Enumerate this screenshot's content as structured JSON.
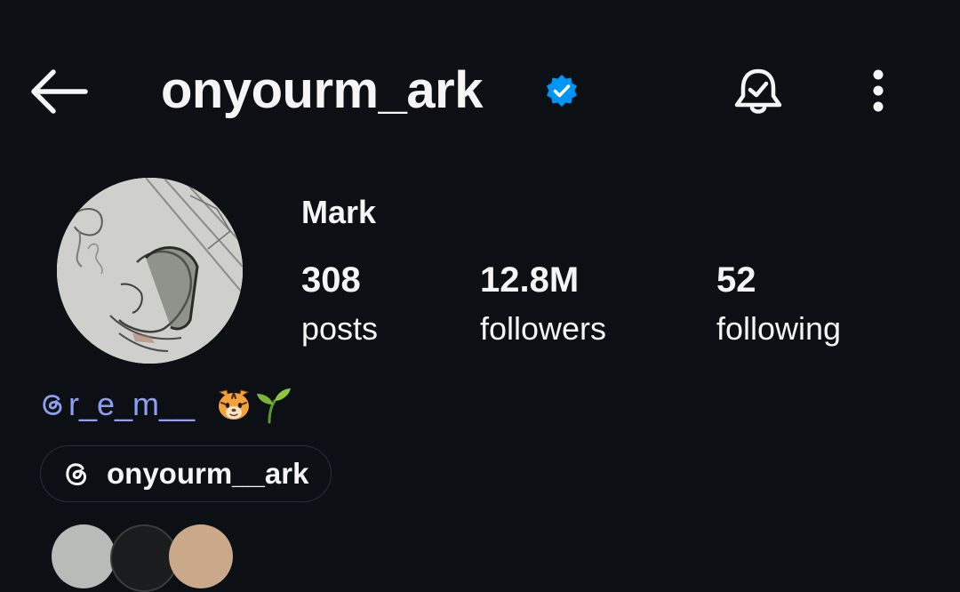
{
  "header": {
    "username": "onyourm_ark",
    "verified": true,
    "icons": [
      "back-arrow-icon",
      "verified-badge-icon",
      "notification-bell-icon",
      "more-options-icon"
    ]
  },
  "profile": {
    "display_name": "Mark",
    "stats": [
      {
        "value": "308",
        "label": "posts"
      },
      {
        "value": "12.8M",
        "label": "followers"
      },
      {
        "value": "52",
        "label": "following"
      }
    ]
  },
  "bio": {
    "mention": "r_e_m__",
    "emoji": [
      "tiger-face",
      "seedling"
    ]
  },
  "threads_link": {
    "label": "onyourm__ark",
    "icon": "threads-icon"
  },
  "colors": {
    "background": "#0c1014",
    "text": "#f5f5f5",
    "verified_blue": "#0095f6",
    "mention_blue": "#8e9ff2",
    "chip_border": "#2a2f36"
  }
}
